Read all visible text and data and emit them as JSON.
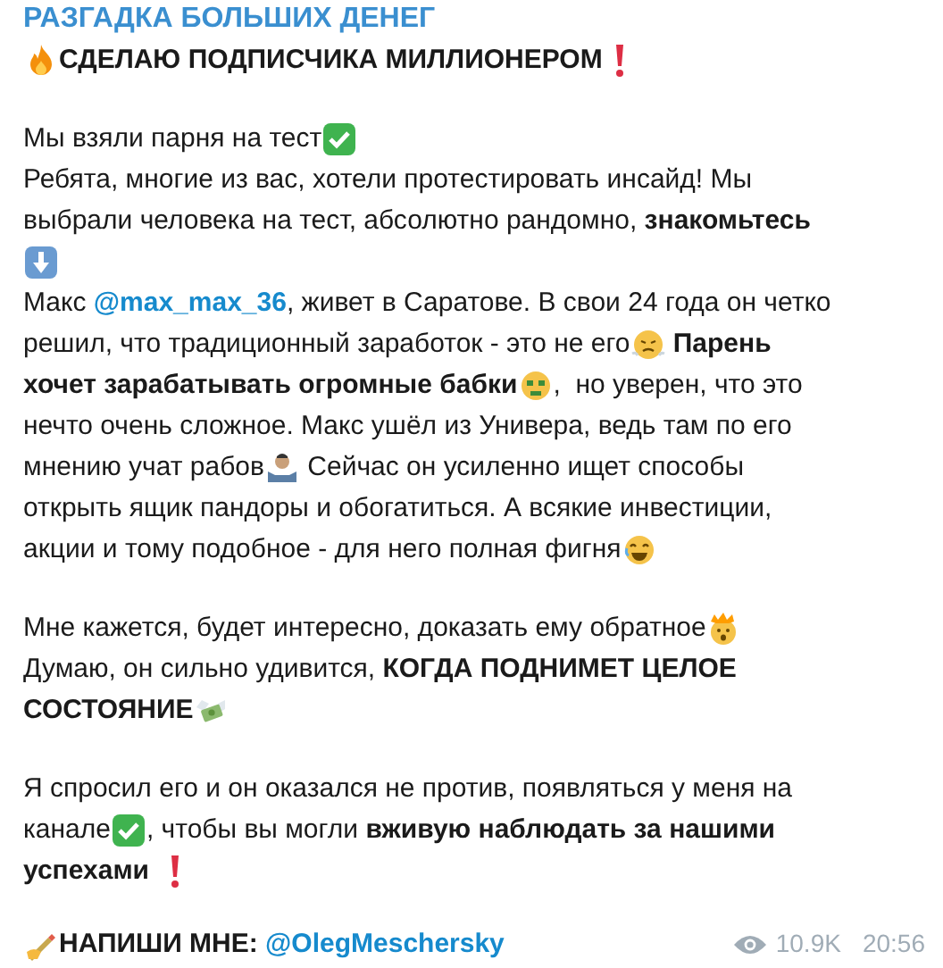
{
  "post": {
    "channel": "РАЗГАДКА БОЛЬШИХ ДЕНЕГ",
    "paragraphs": [
      {
        "lines": [
          {
            "segments": [
              {
                "kind": "fire"
              },
              {
                "kind": "text",
                "text": "СДЕЛАЮ ПОДПИСЧИКА МИЛЛИОНЕРОМ",
                "bold": true
              },
              {
                "kind": "exclaim"
              }
            ]
          }
        ]
      },
      {
        "lines": [
          {
            "segments": [
              {
                "kind": "text",
                "text": "Мы взяли парня на тест",
                "bold": false
              },
              {
                "kind": "check"
              }
            ]
          },
          {
            "segments": [
              {
                "kind": "text",
                "text": "Ребята, многие из вас, хотели протестировать инсайд! Мы",
                "bold": false
              }
            ]
          },
          {
            "segments": [
              {
                "kind": "text",
                "text": "выбрали человека на тест, абсолютно рандомно, ",
                "bold": false
              },
              {
                "kind": "text",
                "text": "знакомьтесь",
                "bold": true
              }
            ]
          },
          {
            "segments": [
              {
                "kind": "down"
              }
            ]
          },
          {
            "segments": [
              {
                "kind": "text",
                "text": "Макс ",
                "bold": false
              },
              {
                "kind": "link",
                "text": "@max_max_36"
              },
              {
                "kind": "text",
                "text": ", живет в Саратове. В свои 24 года он четко",
                "bold": false
              }
            ]
          },
          {
            "segments": [
              {
                "kind": "text",
                "text": "решил, что традиционный заработок - это не его",
                "bold": false
              },
              {
                "kind": "steam"
              },
              {
                "kind": "text",
                "text": " Парень",
                "bold": true
              }
            ]
          },
          {
            "segments": [
              {
                "kind": "text",
                "text": "хочет зарабатывать огромные бабки",
                "bold": true
              },
              {
                "kind": "moneyface"
              },
              {
                "kind": "text",
                "text": ",  но уверен, что это",
                "bold": false
              }
            ]
          },
          {
            "segments": [
              {
                "kind": "text",
                "text": "нечто очень сложное. Макс ушёл из Универа, ведь там по его",
                "bold": false
              }
            ]
          },
          {
            "segments": [
              {
                "kind": "text",
                "text": "мнению учат рабов",
                "bold": false
              },
              {
                "kind": "shrug"
              },
              {
                "kind": "text",
                "text": " Сейчас он усиленно ищет способы",
                "bold": false
              }
            ]
          },
          {
            "segments": [
              {
                "kind": "text",
                "text": "открыть ящик пандоры и обогатиться. А всякие инвестиции,",
                "bold": false
              }
            ]
          },
          {
            "segments": [
              {
                "kind": "text",
                "text": "акции и тому подобное - для него полная фигня",
                "bold": false
              },
              {
                "kind": "laugh"
              }
            ]
          }
        ]
      },
      {
        "lines": [
          {
            "segments": [
              {
                "kind": "text",
                "text": "Мне кажется, будет интересно, доказать ему обратное",
                "bold": false
              },
              {
                "kind": "explode"
              }
            ]
          },
          {
            "segments": [
              {
                "kind": "text",
                "text": "Думаю, он сильно удивится, ",
                "bold": false
              },
              {
                "kind": "text",
                "text": "КОГДА ПОДНИМЕТ ЦЕЛОЕ",
                "bold": true
              }
            ]
          },
          {
            "segments": [
              {
                "kind": "text",
                "text": "СОСТОЯНИЕ",
                "bold": true
              },
              {
                "kind": "money"
              }
            ]
          }
        ]
      },
      {
        "lines": [
          {
            "segments": [
              {
                "kind": "text",
                "text": "Я спросил его и он оказался не против, появляться у меня на",
                "bold": false
              }
            ]
          },
          {
            "segments": [
              {
                "kind": "text",
                "text": "канале",
                "bold": false
              },
              {
                "kind": "check"
              },
              {
                "kind": "text",
                "text": ", чтобы вы могли ",
                "bold": false
              },
              {
                "kind": "text",
                "text": "вживую наблюдать за нашими",
                "bold": true
              }
            ]
          },
          {
            "segments": [
              {
                "kind": "text",
                "text": "успехами ",
                "bold": true
              },
              {
                "kind": "exclaim"
              }
            ]
          }
        ]
      },
      {
        "lines": [
          {
            "segments": [
              {
                "kind": "write"
              },
              {
                "kind": "text",
                "text": "НАПИШИ МНЕ: ",
                "bold": true
              },
              {
                "kind": "link",
                "text": "@OlegMeschersky"
              }
            ]
          }
        ]
      }
    ],
    "views": "10.9K",
    "time": "20:56"
  }
}
